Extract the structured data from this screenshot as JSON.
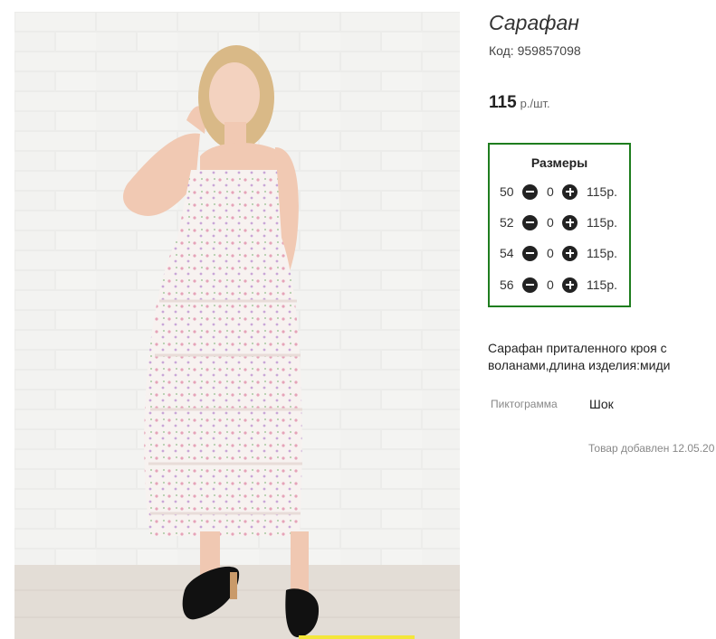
{
  "product": {
    "title": "Сарафан",
    "code": "Код: 959857098",
    "price": {
      "value": "115",
      "unit": "р./шт."
    },
    "image": {
      "semantic": "product-photo-woman-in-floral-tiered-sundress"
    },
    "sizes": {
      "heading": "Размеры",
      "rows": [
        {
          "size": "50",
          "qty": "0",
          "price": "115р."
        },
        {
          "size": "52",
          "qty": "0",
          "price": "115р."
        },
        {
          "size": "54",
          "qty": "0",
          "price": "115р."
        },
        {
          "size": "56",
          "qty": "0",
          "price": "115р."
        }
      ]
    },
    "description": "Сарафан приталенного кроя с воланами,длина изделия:миди",
    "pictogram": {
      "label": "Пиктограмма",
      "value": "Шок"
    },
    "added": "Товар добавлен 12.05.20"
  },
  "colors": {
    "sizes_border": "#1e7d1e",
    "stepper_button": "#222222"
  }
}
